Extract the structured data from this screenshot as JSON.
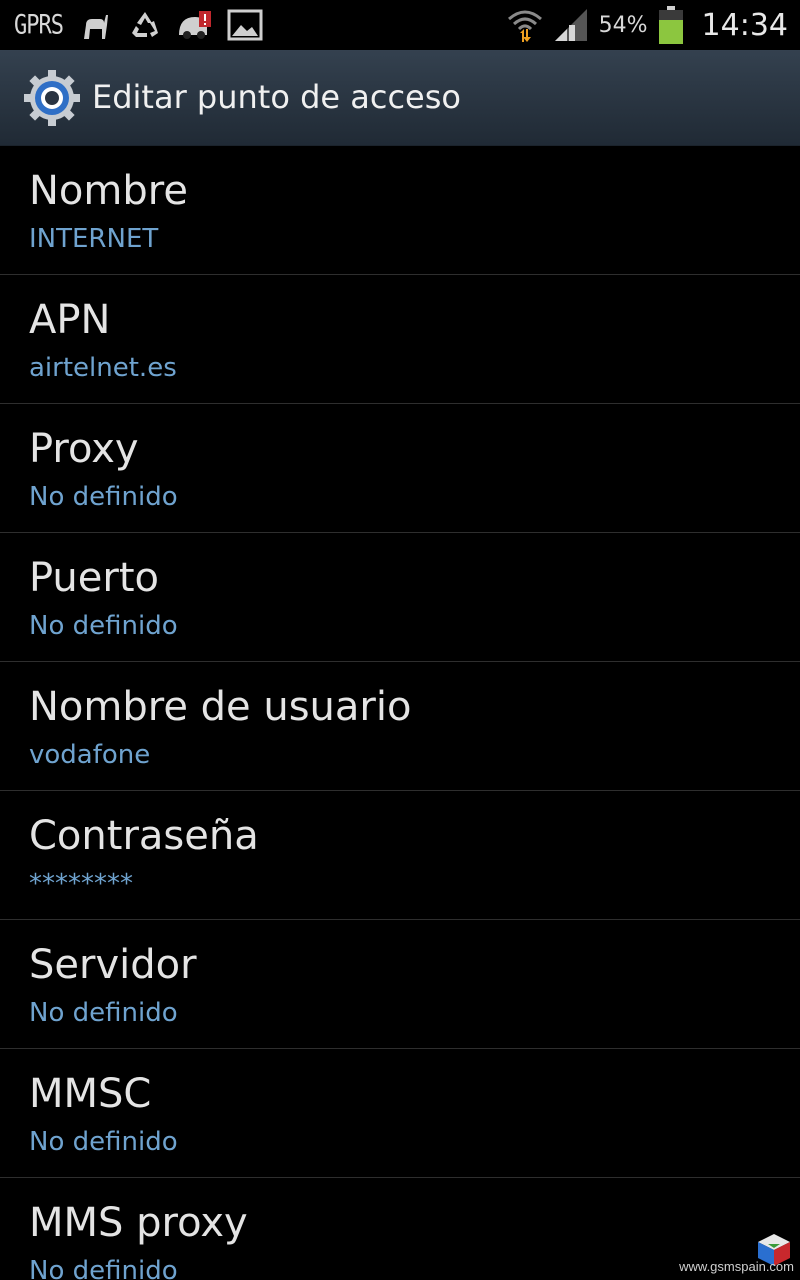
{
  "status_bar": {
    "network_label": "GPRS",
    "battery_percent": "54%",
    "time": "14:34",
    "icons": [
      "android-icon",
      "recycle-icon",
      "speedometer-alert-icon",
      "image-icon",
      "wifi-icon",
      "signal-icon",
      "battery-icon"
    ],
    "battery_color": "#8cc63f"
  },
  "action_bar": {
    "title": "Editar punto de acceso",
    "icon": "settings-gear-icon",
    "accent_color": "#3f7fd1"
  },
  "list": {
    "items": [
      {
        "title": "Nombre",
        "value": "INTERNET"
      },
      {
        "title": "APN",
        "value": "airtelnet.es"
      },
      {
        "title": "Proxy",
        "value": "No definido"
      },
      {
        "title": "Puerto",
        "value": "No definido"
      },
      {
        "title": "Nombre de usuario",
        "value": "vodafone"
      },
      {
        "title": "Contraseña",
        "value": "********"
      },
      {
        "title": "Servidor",
        "value": "No definido"
      },
      {
        "title": "MMSC",
        "value": "No definido"
      },
      {
        "title": "MMS proxy",
        "value": "No definido"
      }
    ],
    "value_color": "#6fa3cf"
  },
  "watermark": {
    "text": "www.gsmspain.com"
  }
}
